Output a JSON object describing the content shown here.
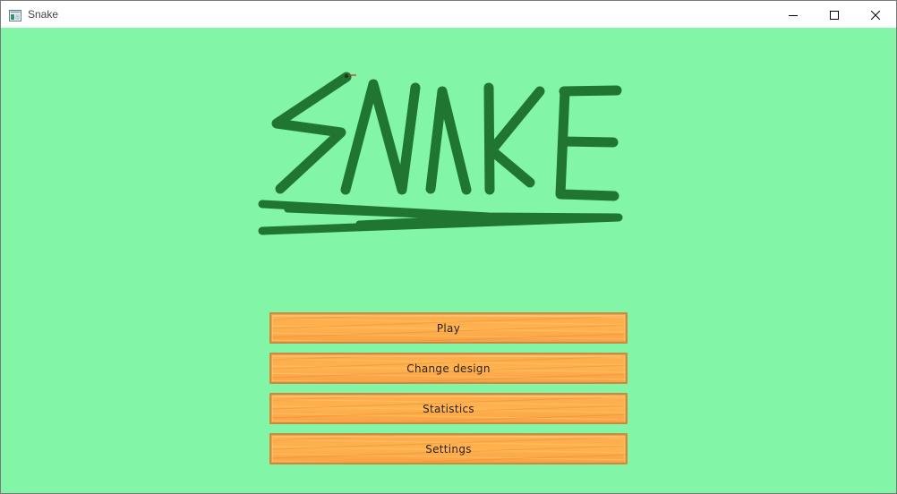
{
  "window": {
    "title": "Snake",
    "controls": {
      "minimize_icon": "minimize-icon",
      "maximize_icon": "maximize-icon",
      "close_icon": "close-icon"
    }
  },
  "background_color": "#82f5a6",
  "logo": {
    "text": "SNAKE",
    "stroke_color": "#207530"
  },
  "menu": {
    "buttons": [
      {
        "label": "Play"
      },
      {
        "label": "Change design"
      },
      {
        "label": "Statistics"
      },
      {
        "label": "Settings"
      }
    ],
    "button_color": "#ffad4a",
    "button_border": "#cc8b3a"
  }
}
